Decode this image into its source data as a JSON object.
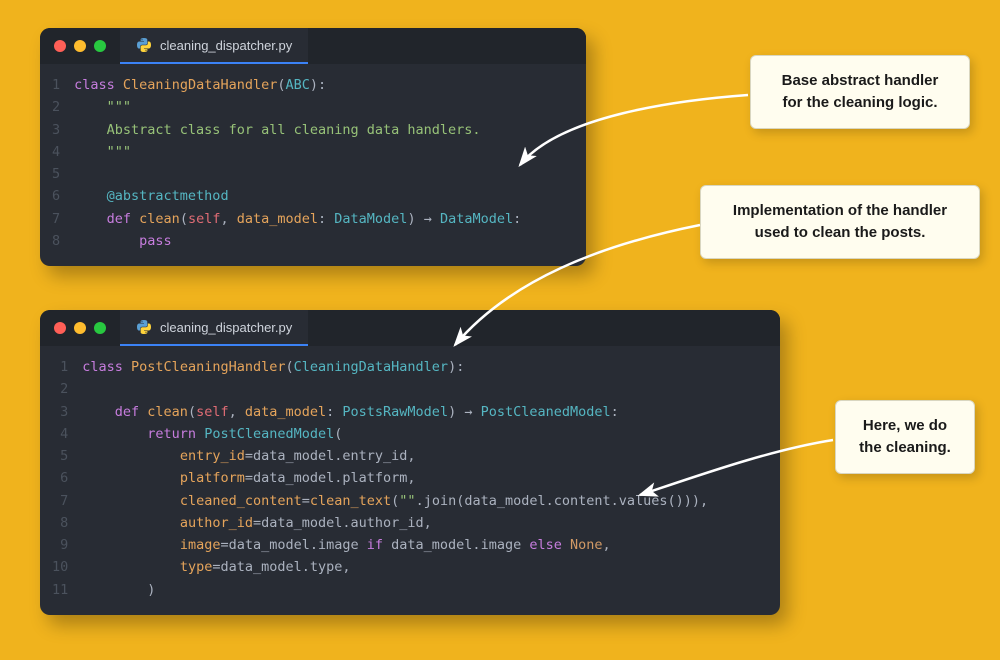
{
  "editor1": {
    "filename": "cleaning_dispatcher.py",
    "gutter": "1\n2\n3\n4\n5\n6\n7\n8",
    "code": {
      "l1_kw": "class ",
      "l1_name": "CleaningDataHandler",
      "l1_paren_open": "(",
      "l1_base": "ABC",
      "l1_paren_close": "):",
      "l2": "    \"\"\"",
      "l3": "    Abstract class for all cleaning data handlers.",
      "l4": "    \"\"\"",
      "l5": "",
      "l6_dec": "    @abstractmethod",
      "l7_kw": "    def ",
      "l7_fn": "clean",
      "l7_open": "(",
      "l7_self": "self",
      "l7_c1": ", ",
      "l7_p1": "data_model",
      "l7_colon1": ": ",
      "l7_t1": "DataModel",
      "l7_close": ") ",
      "l7_arrow": "→",
      "l7_ret": " DataModel",
      "l7_end": ":",
      "l8_kw": "        pass"
    }
  },
  "editor2": {
    "filename": "cleaning_dispatcher.py",
    "gutter": "1\n2\n3\n4\n5\n6\n7\n8\n9\n10\n11",
    "code": {
      "l1_kw": "class ",
      "l1_name": "PostCleaningHandler",
      "l1_open": "(",
      "l1_base": "CleaningDataHandler",
      "l1_close": "):",
      "l2": "",
      "l3_kw": "    def ",
      "l3_fn": "clean",
      "l3_open": "(",
      "l3_self": "self",
      "l3_c1": ", ",
      "l3_p1": "data_model",
      "l3_colon1": ": ",
      "l3_t1": "PostsRawModel",
      "l3_close": ") ",
      "l3_arrow": "→",
      "l3_ret": " PostCleanedModel",
      "l3_end": ":",
      "l4_kw": "        return ",
      "l4_call": "PostCleanedModel",
      "l4_open": "(",
      "l5_pad": "            ",
      "l5_k": "entry_id",
      "l5_eq": "=data_model.entry_id,",
      "l6_pad": "            ",
      "l6_k": "platform",
      "l6_eq": "=data_model.platform,",
      "l7_pad": "            ",
      "l7_k": "cleaned_content",
      "l7_eq": "=",
      "l7_fn": "clean_text",
      "l7_open": "(",
      "l7_str": "\"\"",
      "l7_rest": ".join(data_model.content.values())),",
      "l8_pad": "            ",
      "l8_k": "author_id",
      "l8_eq": "=data_model.author_id,",
      "l9_pad": "            ",
      "l9_k": "image",
      "l9_eq": "=data_model.image ",
      "l9_if": "if",
      "l9_mid": " data_model.image ",
      "l9_else": "else",
      "l9_sp": " ",
      "l9_none": "None",
      "l9_end": ",",
      "l10_pad": "            ",
      "l10_k": "type",
      "l10_eq": "=data_model.type,",
      "l11": "        )"
    }
  },
  "callouts": {
    "c1_line1": "Base abstract handler",
    "c1_line2": "for the cleaning logic.",
    "c2_line1": "Implementation of the handler",
    "c2_line2": "used to clean the posts.",
    "c3_line1": "Here, we do",
    "c3_line2": "the cleaning."
  }
}
